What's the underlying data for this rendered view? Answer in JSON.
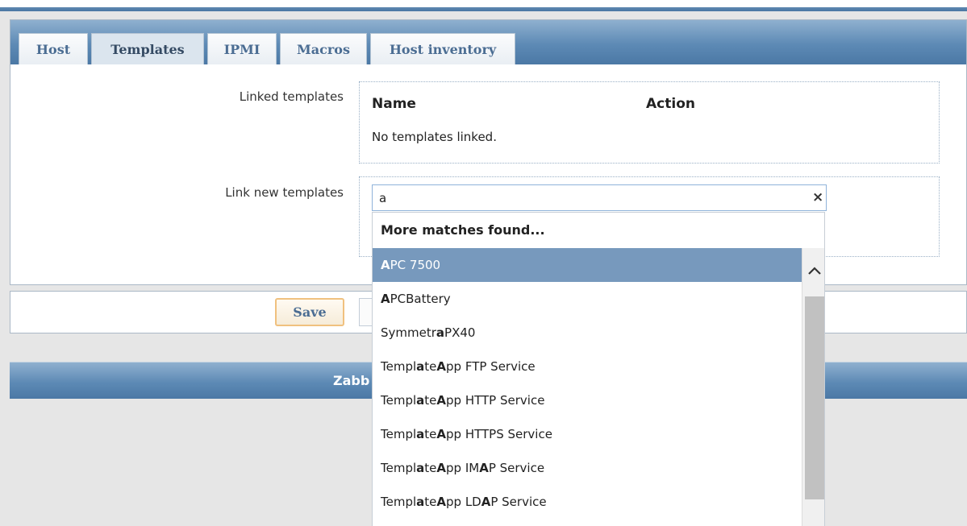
{
  "tabs": [
    {
      "label": "Host"
    },
    {
      "label": "Templates"
    },
    {
      "label": "IPMI"
    },
    {
      "label": "Macros"
    },
    {
      "label": "Host inventory"
    }
  ],
  "linked": {
    "label": "Linked templates",
    "col_name": "Name",
    "col_action": "Action",
    "empty_text": "No templates linked."
  },
  "link_new": {
    "label": "Link new templates",
    "search_value": "a"
  },
  "dropdown": {
    "header": "More matches found...",
    "items": [
      {
        "pre": "",
        "bold": "A",
        "post": "PC 7500"
      },
      {
        "pre": "",
        "bold": "A",
        "post": "PCBattery"
      },
      {
        "pre": "Symmetr",
        "bold": "a",
        "post": " PX40"
      },
      {
        "pre": "Templ",
        "bold": "a",
        "post": "te "
      },
      {
        "pre": "Templ",
        "bold": "a",
        "post": "te "
      },
      {
        "pre": "Templ",
        "bold": "a",
        "post": "te "
      },
      {
        "pre": "Templ",
        "bold": "a",
        "post": "te "
      },
      {
        "pre": "Templ",
        "bold": "a",
        "post": "te "
      }
    ],
    "item_suffix": [
      {
        "b2": "",
        "t2": ""
      },
      {
        "b2": "",
        "t2": ""
      },
      {
        "b2": "",
        "t2": ""
      },
      {
        "b2": "A",
        "t2": "pp FTP Service"
      },
      {
        "b2": "A",
        "t2": "pp HTTP Service"
      },
      {
        "b2": "A",
        "t2": "pp HTTPS Service"
      },
      {
        "b2": "A",
        "t2": "pp IM",
        "b3": "A",
        "t3": "P Service"
      },
      {
        "b2": "A",
        "t2": "pp LD",
        "b3": "A",
        "t3": "P Service"
      }
    ]
  },
  "footer": {
    "save_label": "Save",
    "bar_text": "Zabb"
  },
  "colors": {
    "accent": "#5d8ab5",
    "selected": "#7799bd",
    "save_border": "#f0c17f"
  }
}
